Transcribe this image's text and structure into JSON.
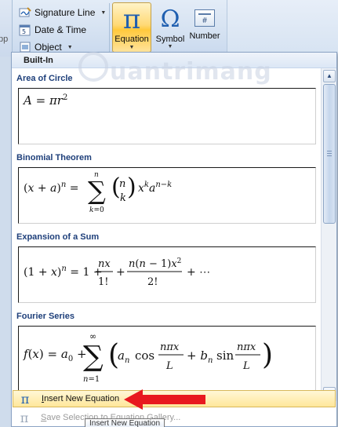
{
  "ribbon": {
    "left_cut_label": "pp",
    "commands": [
      {
        "label": "Signature Line",
        "icon": "signature-line-icon",
        "has_arrow": true
      },
      {
        "label": "Date & Time",
        "icon": "calendar-icon",
        "has_arrow": false
      },
      {
        "label": "Object",
        "icon": "object-icon",
        "has_arrow": true
      }
    ],
    "equation_button": {
      "label": "Equation",
      "glyph": "π"
    },
    "symbol_button": {
      "label": "Symbol",
      "glyph": "Ω"
    },
    "number_button": {
      "label": "Number",
      "glyph": "#"
    }
  },
  "gallery": {
    "header": "Built-In",
    "equations": [
      {
        "title": "Area of Circle"
      },
      {
        "title": "Binomial Theorem"
      },
      {
        "title": "Expansion of a Sum"
      },
      {
        "title": "Fourier Series"
      }
    ]
  },
  "menu": {
    "insert_new_equation": {
      "prefix": "",
      "accel": "I",
      "rest": "nsert New Equation"
    },
    "save_selection": {
      "accel": "S",
      "rest": "ave Selection to Equation Gallery..."
    }
  },
  "tooltip": "Insert New Equation",
  "watermark": "uantrimang",
  "colors": {
    "accent_blue": "#1f5fb0",
    "highlight_gold": "#ffe79a",
    "arrow_red": "#e8191f"
  }
}
